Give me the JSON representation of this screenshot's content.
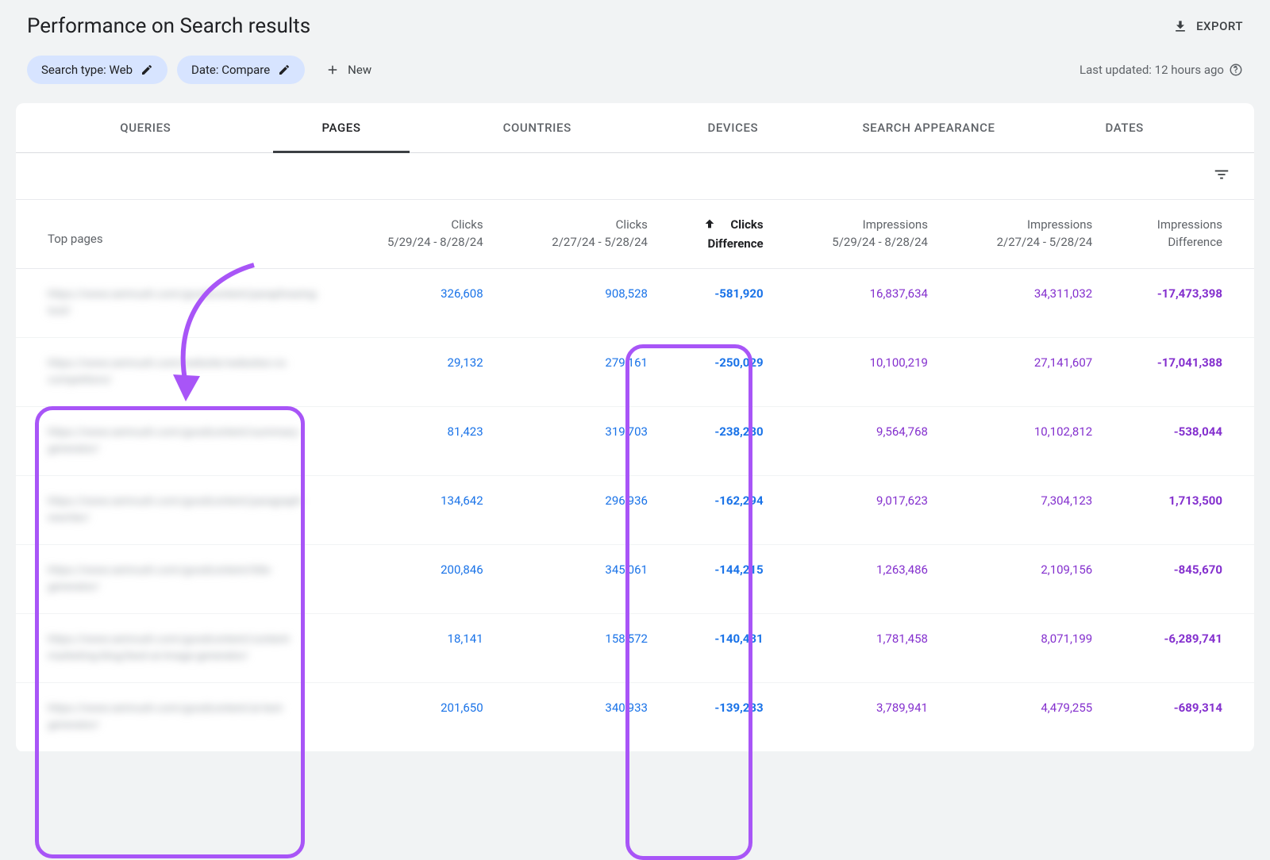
{
  "page_title": "Performance on Search results",
  "export_label": "EXPORT",
  "filters": {
    "search_type": "Search type: Web",
    "date": "Date: Compare",
    "new": "New"
  },
  "last_updated": "Last updated: 12 hours ago",
  "tabs": [
    "QUERIES",
    "PAGES",
    "COUNTRIES",
    "DEVICES",
    "SEARCH APPEARANCE",
    "DATES"
  ],
  "active_tab": 1,
  "table": {
    "top_label": "Top pages",
    "period1": "5/29/24 - 8/28/24",
    "period2": "2/27/24 - 5/28/24",
    "col_clicks": "Clicks",
    "col_clicks_diff_l1": "Clicks",
    "col_clicks_diff_l2": "Difference",
    "col_impr": "Impressions",
    "col_impr_diff_l1": "Impressions",
    "col_impr_diff_l2": "Difference",
    "rows": [
      {
        "page": "https://www.semrush.com/goodcontent/paraphrasing-tool/",
        "c1": "326,608",
        "c2": "908,528",
        "cd": "-581,920",
        "i1": "16,837,634",
        "i2": "34,311,032",
        "id": "-17,473,398"
      },
      {
        "page": "https://www.semrush.com/website/websites-vs-competitors/",
        "c1": "29,132",
        "c2": "279,161",
        "cd": "-250,029",
        "i1": "10,100,219",
        "i2": "27,141,607",
        "id": "-17,041,388"
      },
      {
        "page": "https://www.semrush.com/goodcontent/summary-generator/",
        "c1": "81,423",
        "c2": "319,703",
        "cd": "-238,280",
        "i1": "9,564,768",
        "i2": "10,102,812",
        "id": "-538,044"
      },
      {
        "page": "https://www.semrush.com/goodcontent/paragraph-rewriter/",
        "c1": "134,642",
        "c2": "296,936",
        "cd": "-162,294",
        "i1": "9,017,623",
        "i2": "7,304,123",
        "id": "1,713,500"
      },
      {
        "page": "https://www.semrush.com/goodcontent/title-generator/",
        "c1": "200,846",
        "c2": "345,061",
        "cd": "-144,215",
        "i1": "1,263,486",
        "i2": "2,109,156",
        "id": "-845,670"
      },
      {
        "page": "https://www.semrush.com/goodcontent/content-marketing-blog/best-ai-image-generator/",
        "c1": "18,141",
        "c2": "158,572",
        "cd": "-140,431",
        "i1": "1,781,458",
        "i2": "8,071,199",
        "id": "-6,289,741"
      },
      {
        "page": "https://www.semrush.com/goodcontent/ai-text-generator/",
        "c1": "201,650",
        "c2": "340,933",
        "cd": "-139,283",
        "i1": "3,789,941",
        "i2": "4,479,255",
        "id": "-689,314"
      }
    ]
  }
}
